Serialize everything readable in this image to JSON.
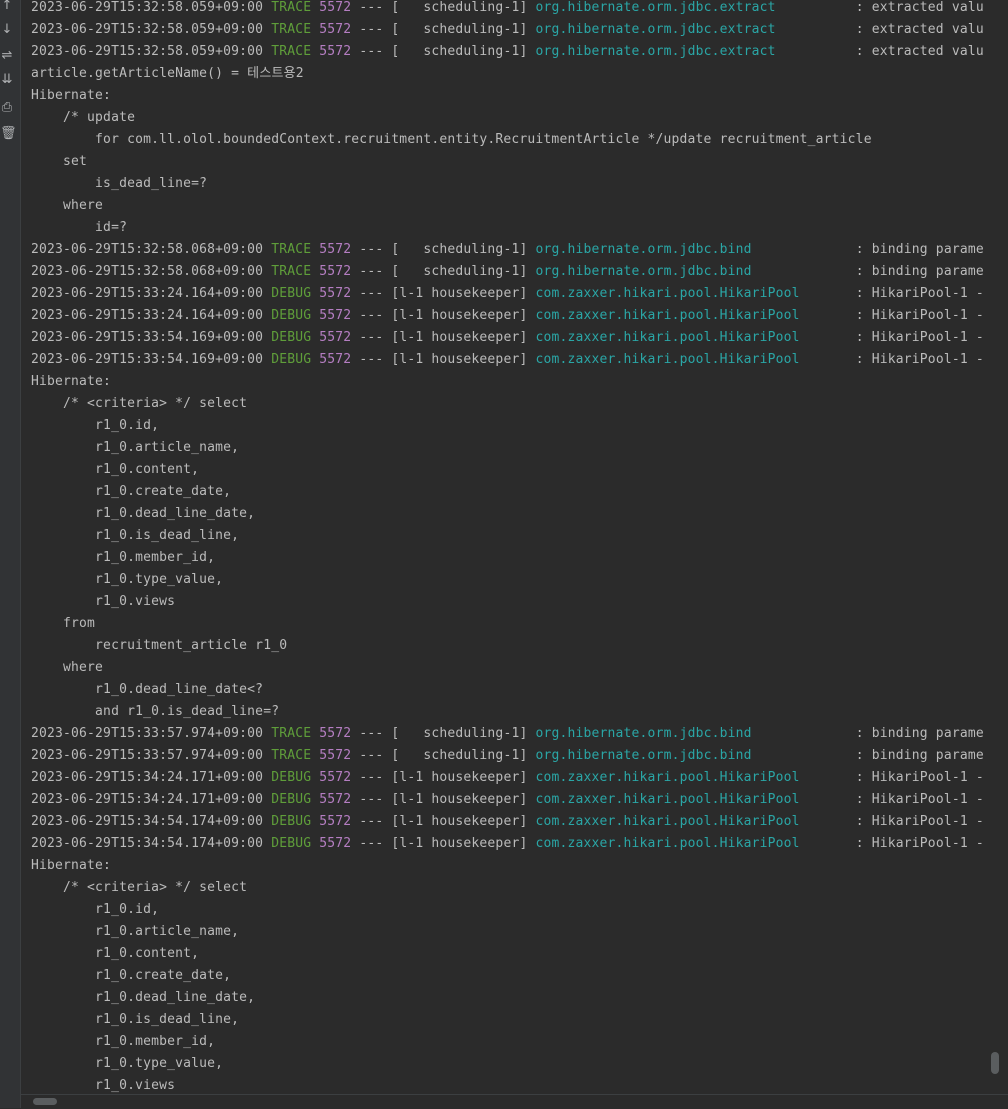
{
  "toolbar": {
    "buttons": [
      {
        "name": "scroll-up-icon",
        "glyph": "↑"
      },
      {
        "name": "scroll-down-icon",
        "glyph": "↓"
      },
      {
        "name": "soft-wrap-icon",
        "glyph": "⇌"
      },
      {
        "name": "scroll-to-end-icon",
        "glyph": "⇊"
      },
      {
        "name": "print-icon",
        "glyph": "⎙"
      },
      {
        "name": "clear-all-icon",
        "glyph": "🗑"
      }
    ]
  },
  "colors": {
    "background": "#2b2b2b",
    "text": "#bbbbbb",
    "level": "#5f9e3a",
    "pid": "#b57ec2",
    "logger": "#2aa6a6"
  },
  "log_lines": [
    {
      "type": "log",
      "ts": "2023-06-29T15:32:58.059+09:00",
      "level": "TRACE",
      "pid": "5572",
      "thread": " --- [   scheduling-1] ",
      "logger": "org.hibernate.orm.jdbc.extract",
      "msg": "          : extracted valu"
    },
    {
      "type": "log",
      "ts": "2023-06-29T15:32:58.059+09:00",
      "level": "TRACE",
      "pid": "5572",
      "thread": " --- [   scheduling-1] ",
      "logger": "org.hibernate.orm.jdbc.extract",
      "msg": "          : extracted valu"
    },
    {
      "type": "log",
      "ts": "2023-06-29T15:32:58.059+09:00",
      "level": "TRACE",
      "pid": "5572",
      "thread": " --- [   scheduling-1] ",
      "logger": "org.hibernate.orm.jdbc.extract",
      "msg": "          : extracted valu"
    },
    {
      "type": "plain",
      "text": "article.getArticleName() = 테스트용2"
    },
    {
      "type": "plain",
      "text": "Hibernate:"
    },
    {
      "type": "plain",
      "text": "    /* update"
    },
    {
      "type": "plain",
      "text": "        for com.ll.olol.boundedContext.recruitment.entity.RecruitmentArticle */update recruitment_article"
    },
    {
      "type": "plain",
      "text": "    set"
    },
    {
      "type": "plain",
      "text": "        is_dead_line=?"
    },
    {
      "type": "plain",
      "text": "    where"
    },
    {
      "type": "plain",
      "text": "        id=?"
    },
    {
      "type": "log",
      "ts": "2023-06-29T15:32:58.068+09:00",
      "level": "TRACE",
      "pid": "5572",
      "thread": " --- [   scheduling-1] ",
      "logger": "org.hibernate.orm.jdbc.bind",
      "msg": "             : binding parame"
    },
    {
      "type": "log",
      "ts": "2023-06-29T15:32:58.068+09:00",
      "level": "TRACE",
      "pid": "5572",
      "thread": " --- [   scheduling-1] ",
      "logger": "org.hibernate.orm.jdbc.bind",
      "msg": "             : binding parame"
    },
    {
      "type": "log",
      "ts": "2023-06-29T15:33:24.164+09:00",
      "level": "DEBUG",
      "pid": "5572",
      "thread": " --- [l-1 housekeeper] ",
      "logger": "com.zaxxer.hikari.pool.HikariPool",
      "msg": "       : HikariPool-1 -"
    },
    {
      "type": "log",
      "ts": "2023-06-29T15:33:24.164+09:00",
      "level": "DEBUG",
      "pid": "5572",
      "thread": " --- [l-1 housekeeper] ",
      "logger": "com.zaxxer.hikari.pool.HikariPool",
      "msg": "       : HikariPool-1 -"
    },
    {
      "type": "log",
      "ts": "2023-06-29T15:33:54.169+09:00",
      "level": "DEBUG",
      "pid": "5572",
      "thread": " --- [l-1 housekeeper] ",
      "logger": "com.zaxxer.hikari.pool.HikariPool",
      "msg": "       : HikariPool-1 -"
    },
    {
      "type": "log",
      "ts": "2023-06-29T15:33:54.169+09:00",
      "level": "DEBUG",
      "pid": "5572",
      "thread": " --- [l-1 housekeeper] ",
      "logger": "com.zaxxer.hikari.pool.HikariPool",
      "msg": "       : HikariPool-1 -"
    },
    {
      "type": "plain",
      "text": "Hibernate:"
    },
    {
      "type": "plain",
      "text": "    /* <criteria> */ select"
    },
    {
      "type": "plain",
      "text": "        r1_0.id,"
    },
    {
      "type": "plain",
      "text": "        r1_0.article_name,"
    },
    {
      "type": "plain",
      "text": "        r1_0.content,"
    },
    {
      "type": "plain",
      "text": "        r1_0.create_date,"
    },
    {
      "type": "plain",
      "text": "        r1_0.dead_line_date,"
    },
    {
      "type": "plain",
      "text": "        r1_0.is_dead_line,"
    },
    {
      "type": "plain",
      "text": "        r1_0.member_id,"
    },
    {
      "type": "plain",
      "text": "        r1_0.type_value,"
    },
    {
      "type": "plain",
      "text": "        r1_0.views"
    },
    {
      "type": "plain",
      "text": "    from"
    },
    {
      "type": "plain",
      "text": "        recruitment_article r1_0"
    },
    {
      "type": "plain",
      "text": "    where"
    },
    {
      "type": "plain",
      "text": "        r1_0.dead_line_date<?"
    },
    {
      "type": "plain",
      "text": "        and r1_0.is_dead_line=?"
    },
    {
      "type": "log",
      "ts": "2023-06-29T15:33:57.974+09:00",
      "level": "TRACE",
      "pid": "5572",
      "thread": " --- [   scheduling-1] ",
      "logger": "org.hibernate.orm.jdbc.bind",
      "msg": "             : binding parame"
    },
    {
      "type": "log",
      "ts": "2023-06-29T15:33:57.974+09:00",
      "level": "TRACE",
      "pid": "5572",
      "thread": " --- [   scheduling-1] ",
      "logger": "org.hibernate.orm.jdbc.bind",
      "msg": "             : binding parame"
    },
    {
      "type": "log",
      "ts": "2023-06-29T15:34:24.171+09:00",
      "level": "DEBUG",
      "pid": "5572",
      "thread": " --- [l-1 housekeeper] ",
      "logger": "com.zaxxer.hikari.pool.HikariPool",
      "msg": "       : HikariPool-1 -"
    },
    {
      "type": "log",
      "ts": "2023-06-29T15:34:24.171+09:00",
      "level": "DEBUG",
      "pid": "5572",
      "thread": " --- [l-1 housekeeper] ",
      "logger": "com.zaxxer.hikari.pool.HikariPool",
      "msg": "       : HikariPool-1 -"
    },
    {
      "type": "log",
      "ts": "2023-06-29T15:34:54.174+09:00",
      "level": "DEBUG",
      "pid": "5572",
      "thread": " --- [l-1 housekeeper] ",
      "logger": "com.zaxxer.hikari.pool.HikariPool",
      "msg": "       : HikariPool-1 -"
    },
    {
      "type": "log",
      "ts": "2023-06-29T15:34:54.174+09:00",
      "level": "DEBUG",
      "pid": "5572",
      "thread": " --- [l-1 housekeeper] ",
      "logger": "com.zaxxer.hikari.pool.HikariPool",
      "msg": "       : HikariPool-1 -"
    },
    {
      "type": "plain",
      "text": "Hibernate:"
    },
    {
      "type": "plain",
      "text": "    /* <criteria> */ select"
    },
    {
      "type": "plain",
      "text": "        r1_0.id,"
    },
    {
      "type": "plain",
      "text": "        r1_0.article_name,"
    },
    {
      "type": "plain",
      "text": "        r1_0.content,"
    },
    {
      "type": "plain",
      "text": "        r1_0.create_date,"
    },
    {
      "type": "plain",
      "text": "        r1_0.dead_line_date,"
    },
    {
      "type": "plain",
      "text": "        r1_0.is_dead_line,"
    },
    {
      "type": "plain",
      "text": "        r1_0.member_id,"
    },
    {
      "type": "plain",
      "text": "        r1_0.type_value,"
    },
    {
      "type": "plain",
      "text": "        r1_0.views"
    }
  ]
}
